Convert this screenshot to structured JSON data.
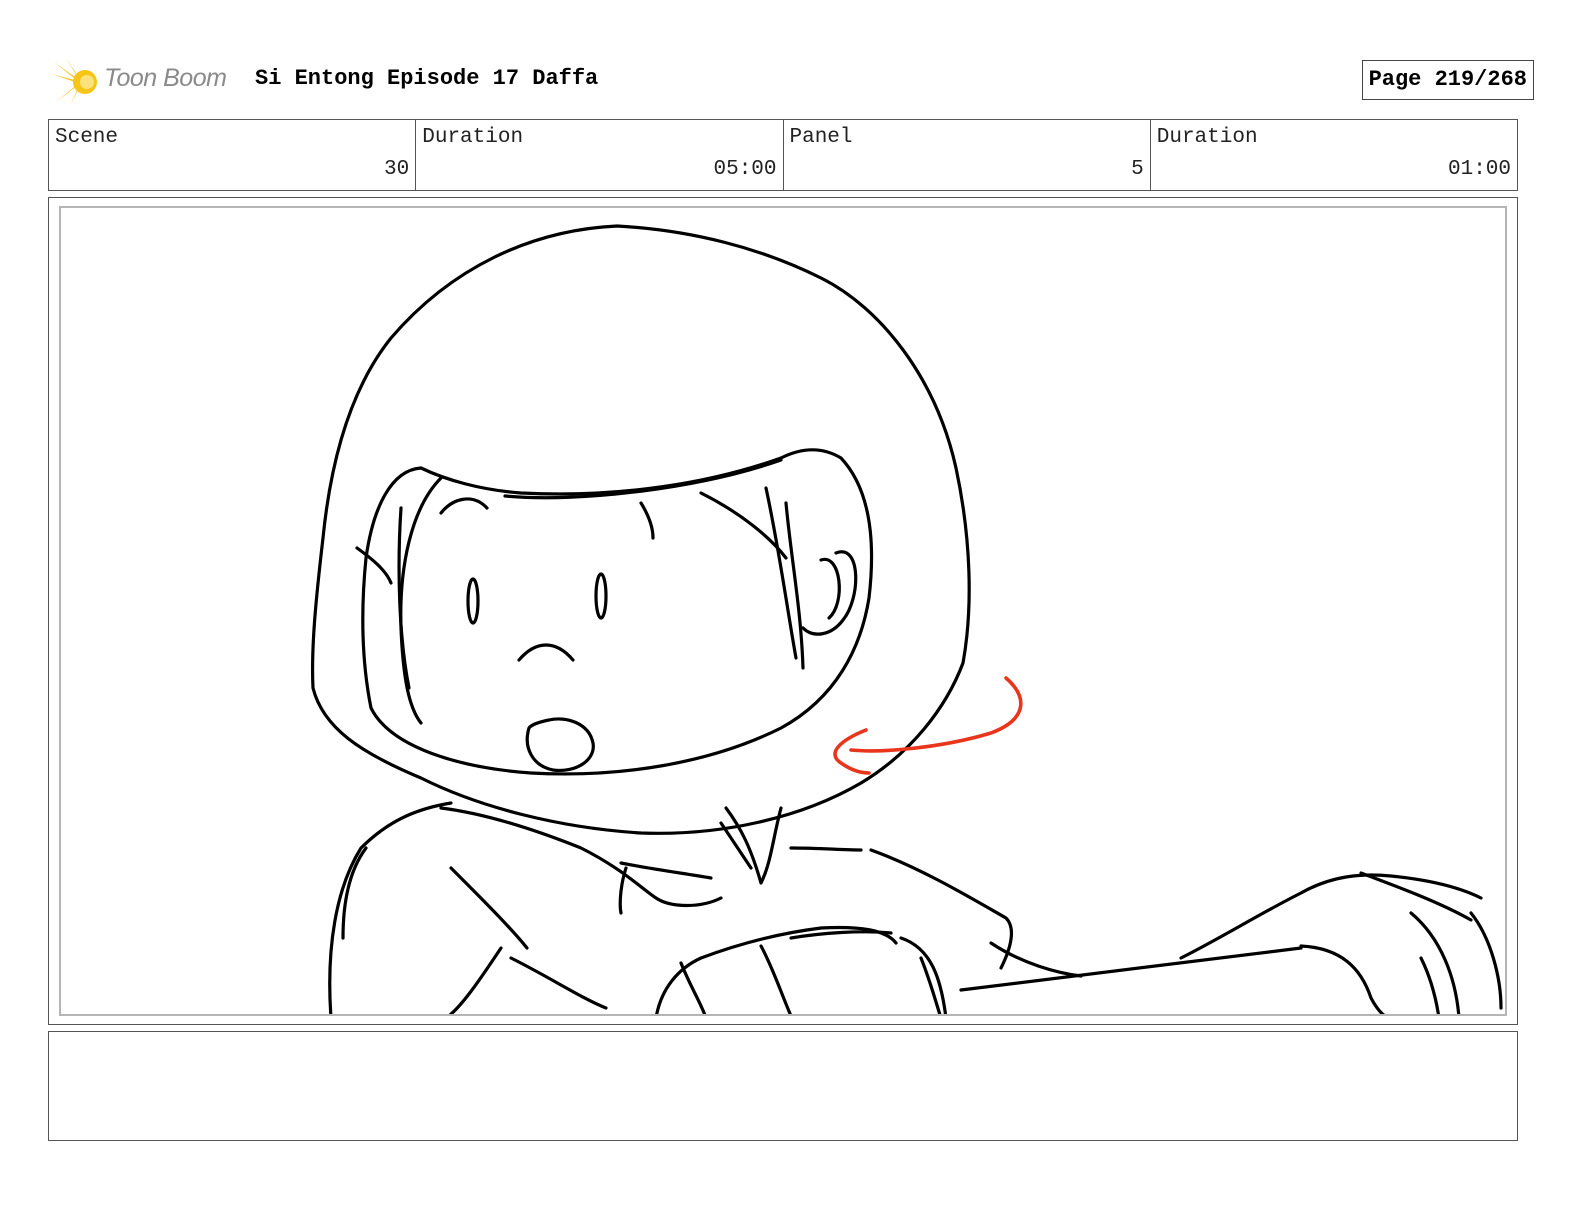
{
  "header": {
    "logo_text": "Toon Boom",
    "title": "Si Entong Episode 17 Daffa",
    "page": "Page 219/268"
  },
  "info": {
    "scene_label": "Scene",
    "scene_value": "30",
    "scene_duration_label": "Duration",
    "scene_duration_value": "05:00",
    "panel_label": "Panel",
    "panel_value": "5",
    "panel_duration_label": "Duration",
    "panel_duration_value": "01:00"
  },
  "colors": {
    "logo_burst": "#f5c518",
    "sketch_line": "#000000",
    "annotation_arrow": "#e8351c"
  },
  "notes": ""
}
